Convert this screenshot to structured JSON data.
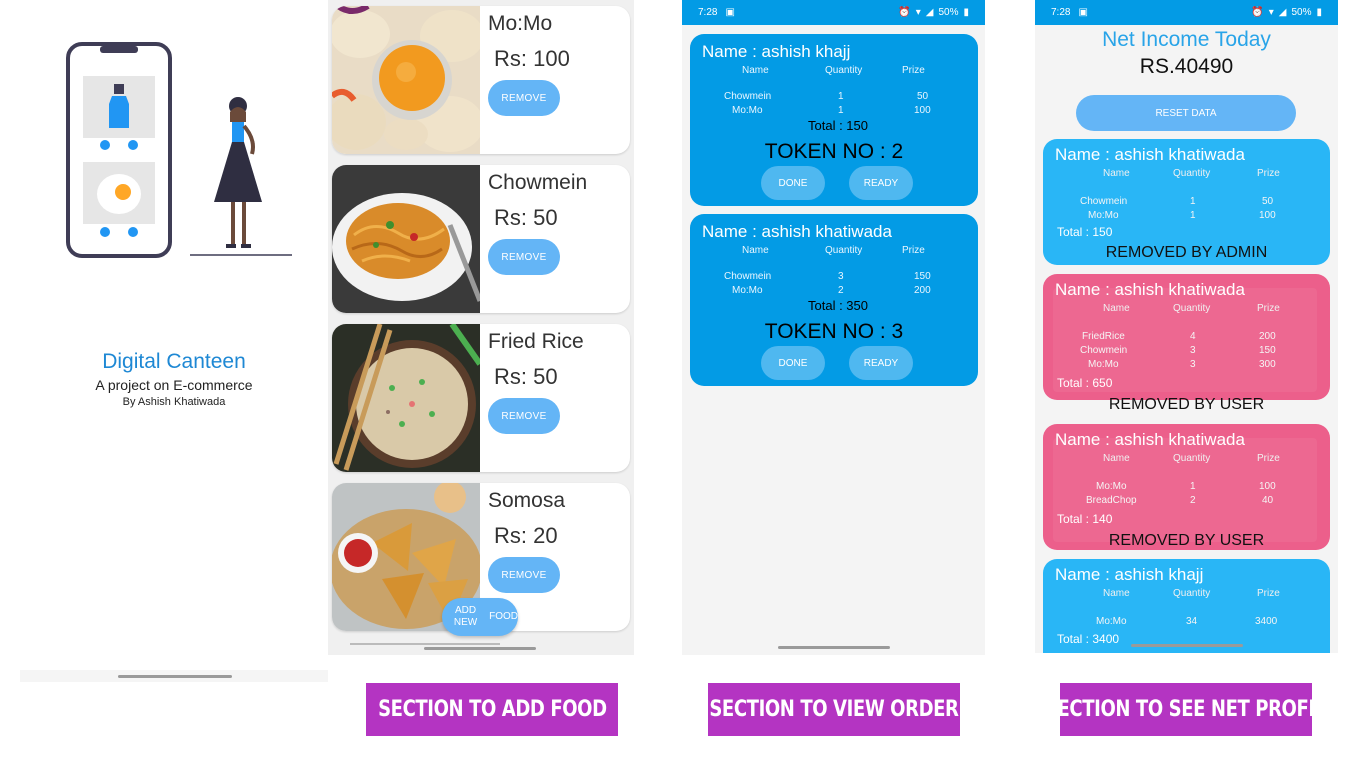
{
  "splash": {
    "title": "Digital Canteen",
    "subtitle": "A project on E-commerce",
    "byline": "By Ashish Khatiwada"
  },
  "food_section": {
    "items": [
      {
        "name": "Mo:Mo",
        "price": "Rs: 100",
        "remove_label": "REMOVE"
      },
      {
        "name": "Chowmein",
        "price": "Rs: 50",
        "remove_label": "REMOVE"
      },
      {
        "name": "Fried Rice",
        "price": "Rs: 50",
        "remove_label": "REMOVE"
      },
      {
        "name": "Somosa",
        "price": "Rs: 20",
        "remove_label": "REMOVE"
      }
    ],
    "add_button_label_line1": "ADD NEW",
    "add_button_label_line2": "FOOD",
    "label": "SECTION TO ADD FOOD"
  },
  "status_bar": {
    "time": "7:28",
    "battery": "50%"
  },
  "order_section": {
    "columns": [
      "Name",
      "Quantity",
      "Prize"
    ],
    "orders": [
      {
        "name": "Name :  ashish khajj",
        "rows": [
          [
            "Chowmein",
            "1",
            "50"
          ],
          [
            "Mo:Mo",
            "1",
            "100"
          ]
        ],
        "total": "Total :   150",
        "token": "TOKEN NO : 2",
        "done_label": "DONE",
        "ready_label": "READY"
      },
      {
        "name": "Name :  ashish khatiwada",
        "rows": [
          [
            "Chowmein",
            "3",
            "150"
          ],
          [
            "Mo:Mo",
            "2",
            "200"
          ]
        ],
        "total": "Total :   350",
        "token": "TOKEN NO : 3",
        "done_label": "DONE",
        "ready_label": "READY"
      }
    ],
    "label": "SECTION TO VIEW ORDER"
  },
  "income_section": {
    "heading": "Net Income Today",
    "amount": "RS.40490",
    "reset_label": "RESET DATA",
    "columns": [
      "Name",
      "Quantity",
      "Prize"
    ],
    "cards": [
      {
        "name": "Name :  ashish khatiwada",
        "rows": [
          [
            "Chowmein",
            "1",
            "50"
          ],
          [
            "Mo:Mo",
            "1",
            "100"
          ]
        ],
        "total": "Total :   150",
        "status": "REMOVED BY ADMIN",
        "color": "#29b6f6"
      },
      {
        "name": "Name :  ashish khatiwada",
        "rows": [
          [
            "FriedRice",
            "4",
            "200"
          ],
          [
            "Chowmein",
            "3",
            "150"
          ],
          [
            "Mo:Mo",
            "3",
            "300"
          ]
        ],
        "total": "Total :   650",
        "status": "REMOVED BY USER",
        "color": "#ec5f8b"
      },
      {
        "name": "Name :  ashish khatiwada",
        "rows": [
          [
            "Mo:Mo",
            "1",
            "100"
          ],
          [
            "BreadChop",
            "2",
            "40"
          ]
        ],
        "total": "Total :   140",
        "status": "REMOVED BY USER",
        "color": "#ec5f8b"
      },
      {
        "name": "Name :  ashish khajj",
        "rows": [
          [
            "Mo:Mo",
            "34",
            "3400"
          ]
        ],
        "total": "Total :   3400",
        "status": "",
        "color": "#29b6f6"
      }
    ],
    "label": "SECTION TO SEE NET PROFIT"
  },
  "colors": {
    "accent_blue": "#039be5",
    "button_blue": "#64b5f6",
    "removed_pink": "#ec5f8b",
    "label_purple": "#b434c2"
  }
}
